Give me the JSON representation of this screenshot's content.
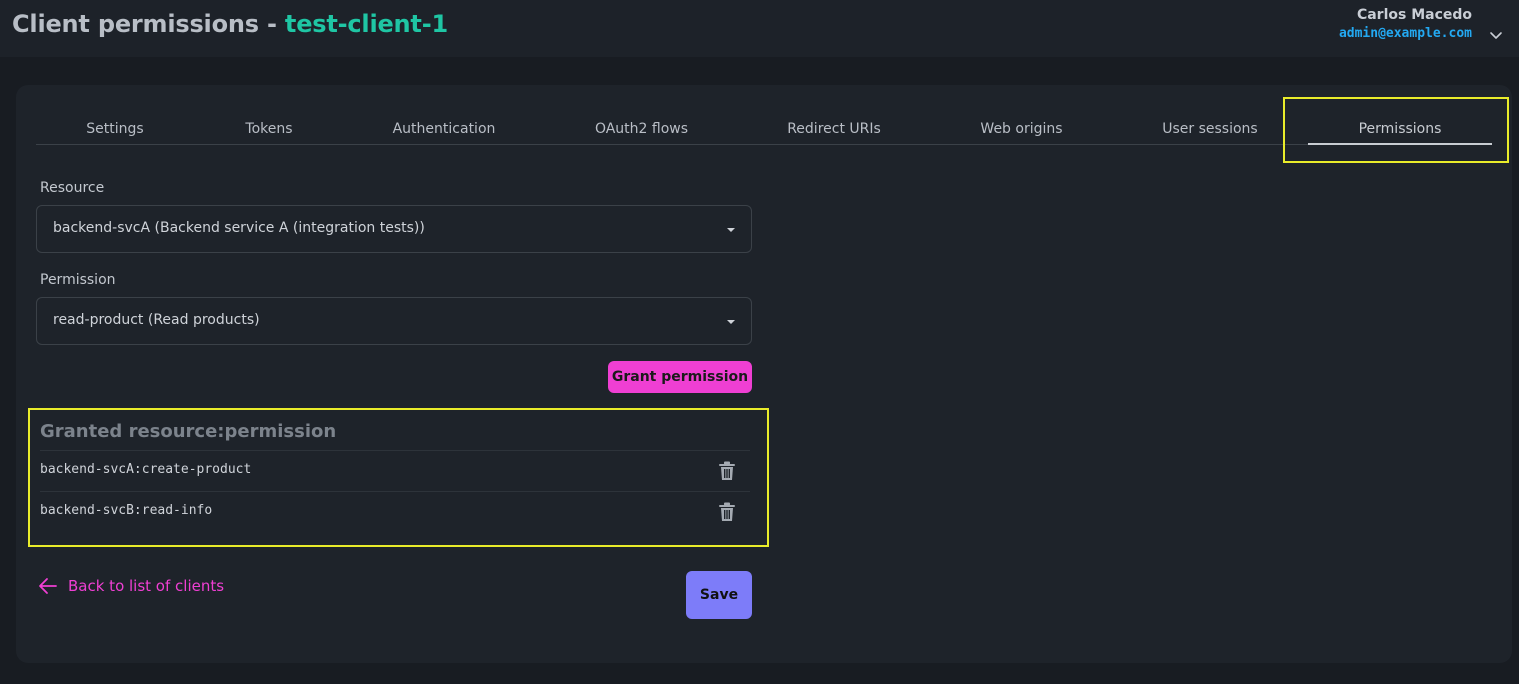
{
  "header": {
    "title_prefix": "Client permissions - ",
    "client_name": "test-client-1",
    "user_name": "Carlos Macedo",
    "user_email": "admin@example.com"
  },
  "tabs": [
    {
      "label": "Settings"
    },
    {
      "label": "Tokens"
    },
    {
      "label": "Authentication"
    },
    {
      "label": "OAuth2 flows"
    },
    {
      "label": "Redirect URIs"
    },
    {
      "label": "Web origins"
    },
    {
      "label": "User sessions"
    },
    {
      "label": "Permissions"
    }
  ],
  "active_tab": "Permissions",
  "form": {
    "resource_label": "Resource",
    "resource_value": "backend-svcA (Backend service A (integration tests))",
    "permission_label": "Permission",
    "permission_value": "read-product (Read products)",
    "grant_button": "Grant permission"
  },
  "granted": {
    "title": "Granted resource:permission",
    "items": [
      {
        "value": "backend-svcA:create-product"
      },
      {
        "value": "backend-svcB:read-info"
      }
    ]
  },
  "footer": {
    "back_label": "Back to list of clients",
    "save_label": "Save"
  },
  "colors": {
    "accent_teal": "#1fc6a4",
    "accent_pink": "#ef3fd3",
    "accent_purple": "#7d7cf9",
    "email_blue": "#23a9f2",
    "highlight_yellow": "#e9ec2a"
  }
}
